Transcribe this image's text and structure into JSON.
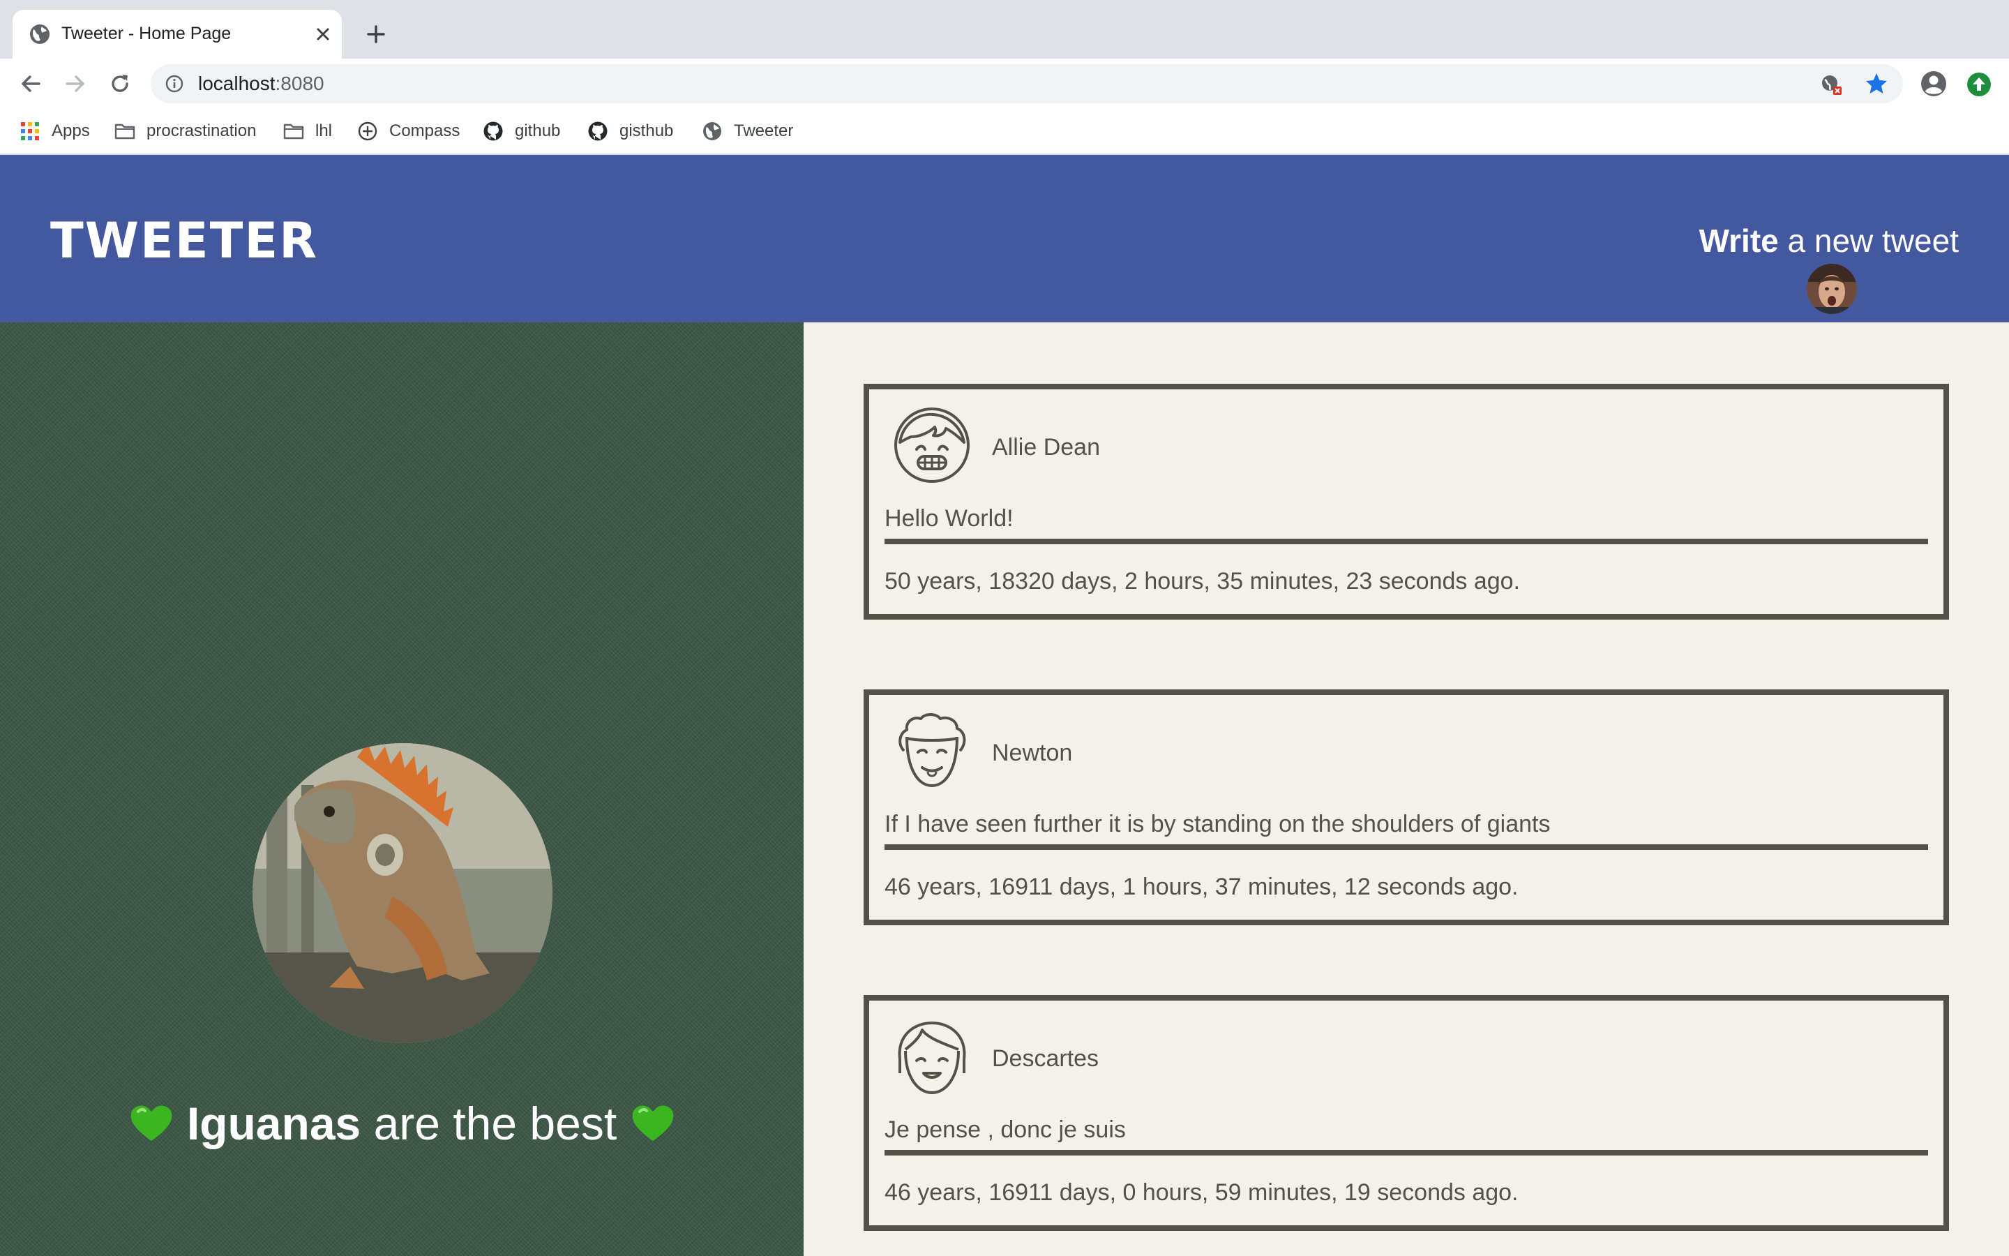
{
  "browser": {
    "tab_title": "Tweeter - Home Page",
    "url_host": "localhost",
    "url_port": ":8080",
    "bookmarks": [
      {
        "label": "Apps",
        "icon": "apps-grid-icon"
      },
      {
        "label": "procrastination",
        "icon": "folder-icon"
      },
      {
        "label": "lhl",
        "icon": "folder-icon"
      },
      {
        "label": "Compass",
        "icon": "compass-icon"
      },
      {
        "label": "github",
        "icon": "github-icon"
      },
      {
        "label": "gisthub",
        "icon": "github-icon"
      },
      {
        "label": "Tweeter",
        "icon": "globe-icon"
      }
    ]
  },
  "header": {
    "logo": "Tweeter",
    "compose_bold": "Write",
    "compose_rest": " a new tweet"
  },
  "profile": {
    "tagline_bold": "Iguanas",
    "tagline_rest": " are the best"
  },
  "tweets": [
    {
      "name": "Allie Dean",
      "content": "Hello World!",
      "time": "50 years, 18320 days, 2 hours, 35 minutes, 23 seconds ago."
    },
    {
      "name": "Newton",
      "content": "If I have seen further it is by standing on the shoulders of giants",
      "time": "46 years, 16911 days, 1 hours, 37 minutes, 12 seconds ago."
    },
    {
      "name": "Descartes",
      "content": "Je pense , donc je suis",
      "time": "46 years, 16911 days, 0 hours, 59 minutes, 19 seconds ago."
    }
  ],
  "colors": {
    "header": "#4458a0",
    "profile_panel": "#3b5544",
    "feed_bg": "#f4f1ec",
    "tweet_border": "#545149"
  }
}
